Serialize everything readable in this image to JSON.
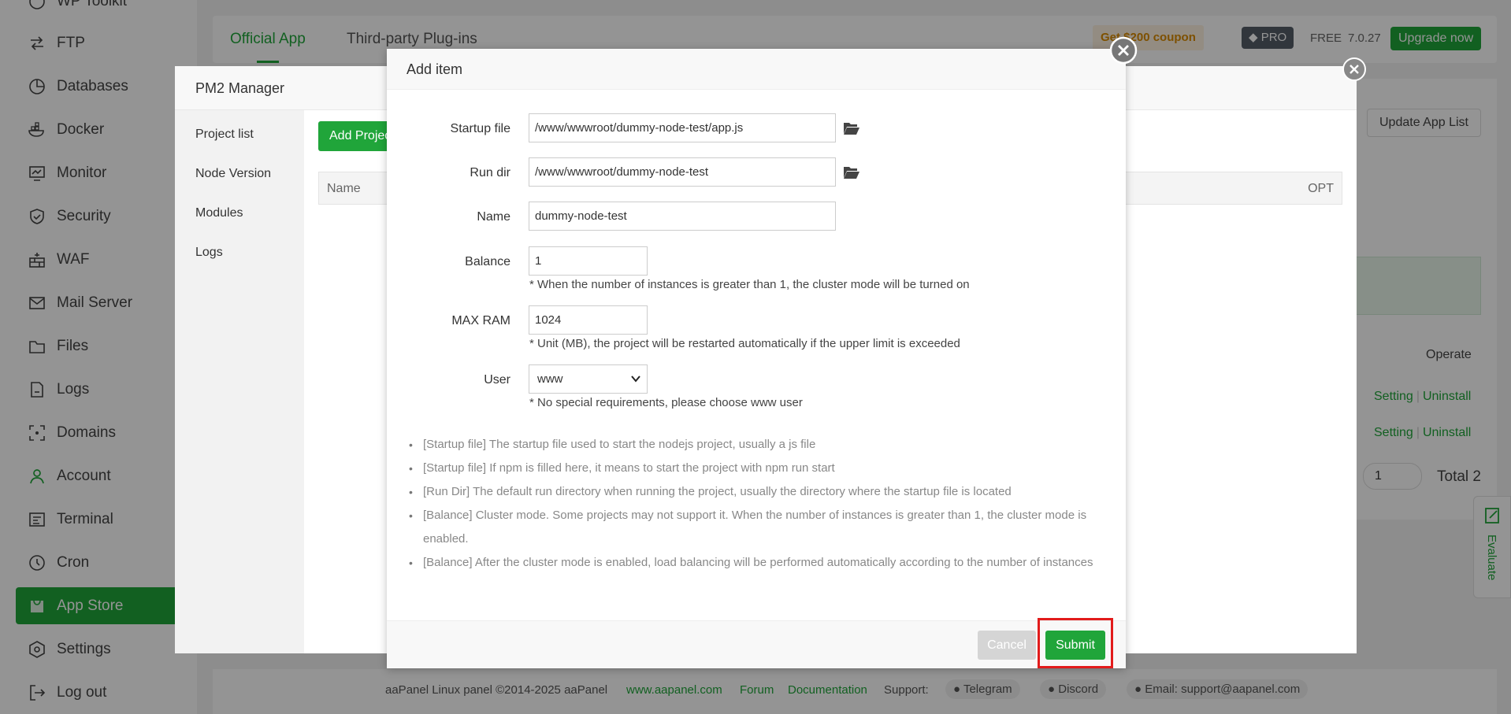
{
  "sidebar": {
    "items": [
      {
        "label": "WP Toolkit",
        "icon": "wordpress-icon"
      },
      {
        "label": "FTP",
        "icon": "ftp-icon"
      },
      {
        "label": "Databases",
        "icon": "database-icon"
      },
      {
        "label": "Docker",
        "icon": "docker-icon"
      },
      {
        "label": "Monitor",
        "icon": "monitor-icon"
      },
      {
        "label": "Security",
        "icon": "shield-icon"
      },
      {
        "label": "WAF",
        "icon": "firewall-icon"
      },
      {
        "label": "Mail Server",
        "icon": "mail-icon"
      },
      {
        "label": "Files",
        "icon": "folder-icon"
      },
      {
        "label": "Logs",
        "icon": "log-icon"
      },
      {
        "label": "Domains",
        "icon": "domain-icon"
      },
      {
        "label": "Account",
        "icon": "user-icon"
      },
      {
        "label": "Terminal",
        "icon": "terminal-icon"
      },
      {
        "label": "Cron",
        "icon": "clock-icon"
      },
      {
        "label": "App Store",
        "icon": "store-icon",
        "active": true
      },
      {
        "label": "Settings",
        "icon": "gear-icon"
      },
      {
        "label": "Log out",
        "icon": "logout-icon"
      }
    ]
  },
  "topbar": {
    "tab_official": "Official App",
    "tab_third": "Third-party Plug-ins",
    "coupon": "Get $200 coupon",
    "pro": "PRO",
    "free": "FREE",
    "version": "7.0.27",
    "upgrade": "Upgrade now"
  },
  "app_store": {
    "update_list": "Update App List",
    "operate": "Operate",
    "setting": "Setting",
    "uninstall": "Uninstall",
    "page": "1",
    "total": "Total 2",
    "evaluate": "Evaluate"
  },
  "footer": {
    "copyright": "aaPanel Linux panel ©2014-2025 aaPanel",
    "site": "www.aapanel.com",
    "forum": "Forum",
    "docs": "Documentation",
    "support": "Support:",
    "telegram": "Telegram",
    "discord": "Discord",
    "email": "Email: support@aapanel.com"
  },
  "pm2": {
    "title": "PM2 Manager",
    "nav": [
      "Project list",
      "Node Version",
      "Modules",
      "Logs"
    ],
    "add_project": "Add Project",
    "col_name": "Name",
    "col_opt": "OPT"
  },
  "modal": {
    "title": "Add item",
    "startup_label": "Startup file",
    "startup_value": "/www/wwwroot/dummy-node-test/app.js",
    "rundir_label": "Run dir",
    "rundir_value": "/www/wwwroot/dummy-node-test",
    "name_label": "Name",
    "name_value": "dummy-node-test",
    "balance_label": "Balance",
    "balance_value": "1",
    "balance_hint": "* When the number of instances is greater than 1, the cluster mode will be turned on",
    "maxram_label": "MAX RAM",
    "maxram_value": "1024",
    "maxram_hint": "* Unit (MB), the project will be restarted automatically if the upper limit is exceeded",
    "user_label": "User",
    "user_value": "www",
    "user_hint": "* No special requirements, please choose www user",
    "notes": [
      "[Startup file] The startup file used to start the nodejs project, usually a js file",
      "[Startup file] If npm is filled here, it means to start the project with npm run start",
      "[Run Dir] The default run directory when running the project, usually the directory where the startup file is located",
      "[Balance] Cluster mode. Some projects may not support it. When the number of instances is greater than 1, the cluster mode is enabled.",
      "[Balance] After the cluster mode is enabled, load balancing will be performed automatically according to the number of instances"
    ],
    "cancel": "Cancel",
    "submit": "Submit"
  },
  "colors": {
    "accent": "#20a53a",
    "highlight": "#e21b1b"
  }
}
